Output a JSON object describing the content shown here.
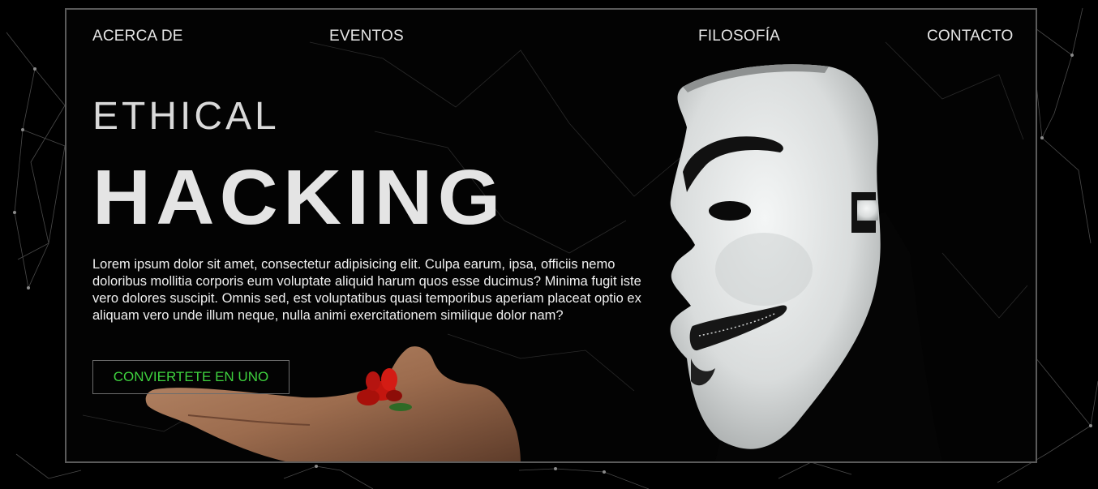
{
  "nav": {
    "about": "ACERCA DE",
    "events": "EVENTOS",
    "philosophy": "FILOSOFÍA",
    "contact": "CONTACTO"
  },
  "hero": {
    "title_small": "ETHICAL",
    "title_large": "HACKING",
    "paragraph": "Lorem ipsum dolor sit amet, consectetur adipisicing elit. Culpa earum, ipsa, officiis nemo doloribus mollitia corporis eum voluptate aliquid harum quos esse ducimus? Minima fugit iste vero dolores suscipit. Omnis sed, est voluptatibus quasi temporibus aperiam placeat optio ex aliquam vero unde illum neque, nulla animi exercitationem similique dolor nam?",
    "cta_label": "CONVIERTETE EN UNO"
  },
  "colors": {
    "background": "#000000",
    "frame_border": "#5a5a5a",
    "nav_text": "#e6e6e6",
    "cta_text": "#3ed13e",
    "mask": "#e2e4e4"
  },
  "icons": {
    "mask_image": "guy-fawkes-mask-icon",
    "hand_image": "hand-with-red-flower-icon"
  }
}
